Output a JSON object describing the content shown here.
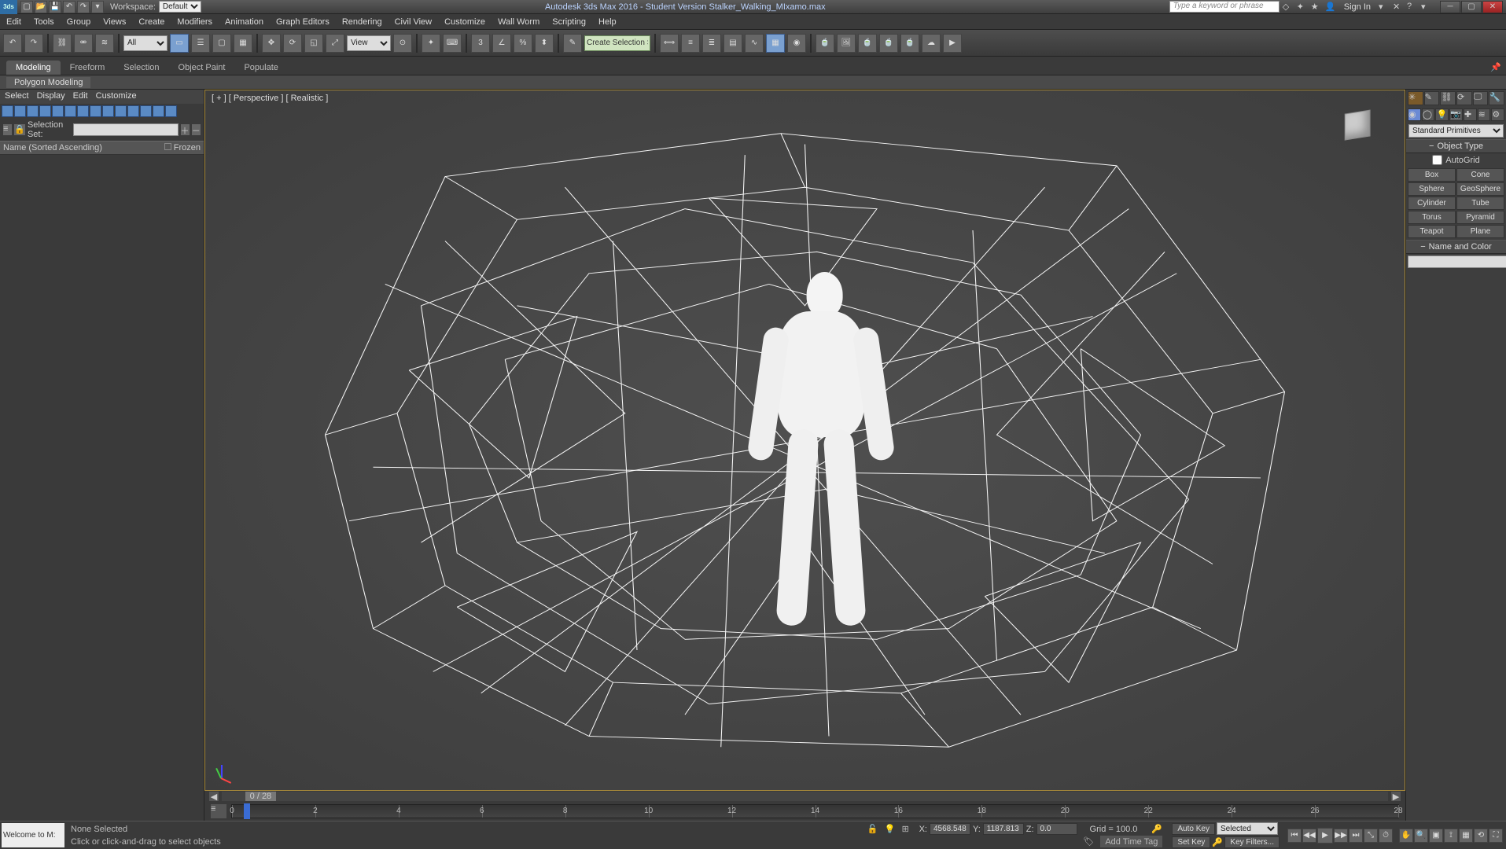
{
  "app": {
    "title": "Autodesk 3ds Max 2016 - Student Version    Stalker_Walking_MIxamo.max",
    "logo_text": "3ds",
    "workspace_label": "Workspace:",
    "workspace_value": "Default",
    "search_placeholder": "Type a keyword or phrase",
    "signin": "Sign In"
  },
  "menubar": [
    "Edit",
    "Tools",
    "Group",
    "Views",
    "Create",
    "Modifiers",
    "Animation",
    "Graph Editors",
    "Rendering",
    "Civil View",
    "Customize",
    "Wall Worm",
    "Scripting",
    "Help"
  ],
  "toolbar": {
    "filter_all": "All",
    "view_label": "View",
    "selset_placeholder": "Create Selection Se"
  },
  "ribbon": {
    "tabs": [
      "Modeling",
      "Freeform",
      "Selection",
      "Object Paint",
      "Populate"
    ],
    "active": 0,
    "sub": "Polygon Modeling"
  },
  "scene": {
    "menu": [
      "Select",
      "Display",
      "Edit",
      "Customize"
    ],
    "selset_label": "Selection Set:",
    "col_name": "Name (Sorted Ascending)",
    "col_frozen": "Frozen"
  },
  "viewport": {
    "label": "[ + ] [ Perspective ] [ Realistic ]",
    "slider_text": "0 / 28",
    "timeline_ticks": [
      0,
      2,
      4,
      6,
      8,
      10,
      12,
      14,
      16,
      18,
      20,
      22,
      24,
      26,
      28
    ]
  },
  "cmdpanel": {
    "dropdown": "Standard Primitives",
    "object_type": "Object Type",
    "autogrid": "AutoGrid",
    "buttons": [
      "Box",
      "Cone",
      "Sphere",
      "GeoSphere",
      "Cylinder",
      "Tube",
      "Torus",
      "Pyramid",
      "Teapot",
      "Plane"
    ],
    "name_and_color": "Name and Color"
  },
  "status": {
    "welcome": "Welcome to M:",
    "sel": "None Selected",
    "hint": "Click or click-and-drag to select objects",
    "x": "4568.548",
    "y": "1187.813",
    "z": "0.0",
    "grid": "Grid = 100.0",
    "autokey": "Auto Key",
    "setkey": "Set Key",
    "selected": "Selected",
    "keyfilters": "Key Filters...",
    "addtimetag": "Add Time Tag"
  }
}
